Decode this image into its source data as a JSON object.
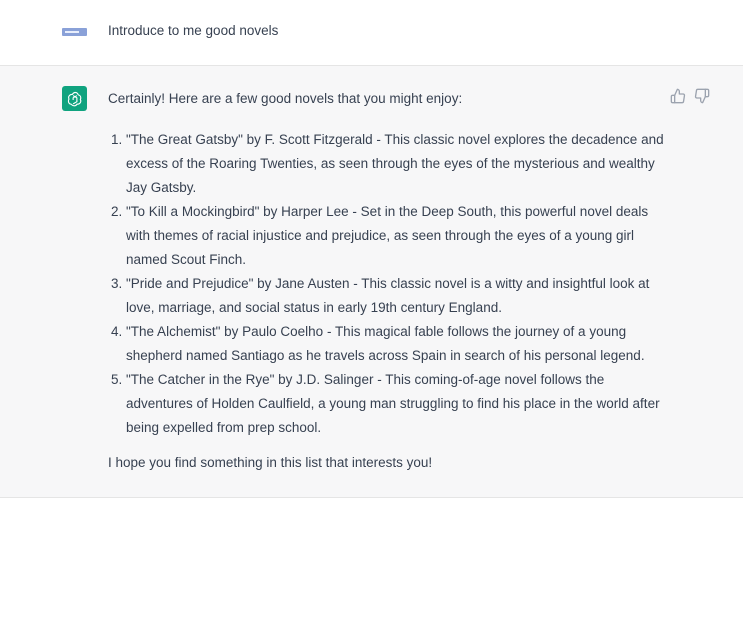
{
  "conversation": {
    "user_message": "Introduce to me good novels",
    "assistant_intro": "Certainly! Here are a few good novels that you might enjoy:",
    "novels": [
      "\"The Great Gatsby\" by F. Scott Fitzgerald - This classic novel explores the decadence and excess of the Roaring Twenties, as seen through the eyes of the mysterious and wealthy Jay Gatsby.",
      "\"To Kill a Mockingbird\" by Harper Lee - Set in the Deep South, this powerful novel deals with themes of racial injustice and prejudice, as seen through the eyes of a young girl named Scout Finch.",
      "\"Pride and Prejudice\" by Jane Austen - This classic novel is a witty and insightful look at love, marriage, and social status in early 19th century England.",
      "\"The Alchemist\" by Paulo Coelho - This magical fable follows the journey of a young shepherd named Santiago as he travels across Spain in search of his personal legend.",
      "\"The Catcher in the Rye\" by J.D. Salinger - This coming-of-age novel follows the adventures of Holden Caulfield, a young man struggling to find his place in the world after being expelled from prep school."
    ],
    "assistant_outro": "I hope you find something in this list that interests you!"
  },
  "icons": {
    "user_avatar": "user-avatar-image",
    "assistant_avatar": "openai-logo-icon",
    "like": "thumbs-up-icon",
    "dislike": "thumbs-down-icon"
  },
  "colors": {
    "assistant_bg": "#f7f7f8",
    "assistant_avatar_bg": "#10a37f",
    "text": "#374151",
    "icon_gray": "#9ca3af"
  }
}
